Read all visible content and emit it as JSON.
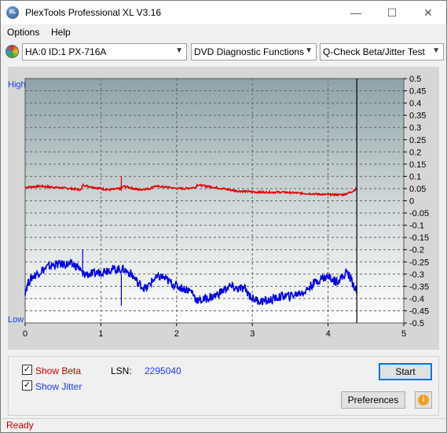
{
  "window": {
    "title": "PlexTools Professional XL V3.16",
    "icon_label": "XL",
    "minimize": "—",
    "maximize": "☐",
    "close": "✕"
  },
  "menu": {
    "options": "Options",
    "help": "Help"
  },
  "toolbar": {
    "drive": "HA:0 ID:1  PX-716A",
    "function": "DVD Diagnostic Functions",
    "test": "Q-Check Beta/Jitter Test"
  },
  "chart_data": {
    "type": "line",
    "left_axis": {
      "high_label": "High",
      "low_label": "Low"
    },
    "right_axis": {
      "ticks": [
        "0.5",
        "0.45",
        "0.4",
        "0.35",
        "0.3",
        "0.25",
        "0.2",
        "0.15",
        "0.1",
        "0.05",
        "0",
        "-0.05",
        "-0.1",
        "-0.15",
        "-0.2",
        "-0.25",
        "-0.3",
        "-0.35",
        "-0.4",
        "-0.45",
        "-0.5"
      ],
      "ylim": [
        -0.5,
        0.5
      ]
    },
    "x_axis": {
      "ticks": [
        "0",
        "1",
        "2",
        "3",
        "4",
        "5"
      ],
      "xlim": [
        0,
        5
      ]
    },
    "grid": true,
    "cursor_x": 4.38,
    "series": [
      {
        "color": "#e00000",
        "x": [
          0,
          0.2,
          0.4,
          0.6,
          0.74,
          0.76,
          0.9,
          1.1,
          1.27,
          1.3,
          1.5,
          1.65,
          1.7,
          1.9,
          2.0,
          2.1,
          2.25,
          2.27,
          2.5,
          2.8,
          3.1,
          3.4,
          3.7,
          4.0,
          4.2,
          4.3,
          4.38
        ],
        "y": [
          0.055,
          0.06,
          0.055,
          0.05,
          0.045,
          0.065,
          0.055,
          0.045,
          0.05,
          0.06,
          0.045,
          0.05,
          0.06,
          0.055,
          0.05,
          0.05,
          0.055,
          0.065,
          0.055,
          0.04,
          0.035,
          0.035,
          0.03,
          0.025,
          0.025,
          0.035,
          0.05
        ]
      },
      {
        "color": "#0000e0",
        "x": [
          0,
          0.05,
          0.1,
          0.2,
          0.3,
          0.4,
          0.5,
          0.6,
          0.7,
          0.74,
          0.76,
          0.9,
          1.0,
          1.1,
          1.2,
          1.3,
          1.4,
          1.5,
          1.6,
          1.7,
          1.8,
          1.9,
          2.0,
          2.1,
          2.2,
          2.25,
          2.3,
          2.4,
          2.5,
          2.6,
          2.7,
          2.8,
          2.9,
          3.0,
          3.1,
          3.2,
          3.3,
          3.4,
          3.5,
          3.6,
          3.7,
          3.8,
          3.9,
          4.0,
          4.1,
          4.2,
          4.25,
          4.3,
          4.35,
          4.38
        ],
        "y": [
          -0.37,
          -0.33,
          -0.31,
          -0.29,
          -0.27,
          -0.26,
          -0.26,
          -0.26,
          -0.27,
          -0.29,
          -0.3,
          -0.3,
          -0.29,
          -0.28,
          -0.28,
          -0.28,
          -0.3,
          -0.34,
          -0.36,
          -0.32,
          -0.31,
          -0.33,
          -0.35,
          -0.36,
          -0.37,
          -0.4,
          -0.41,
          -0.4,
          -0.39,
          -0.37,
          -0.35,
          -0.36,
          -0.36,
          -0.4,
          -0.41,
          -0.41,
          -0.4,
          -0.39,
          -0.39,
          -0.38,
          -0.37,
          -0.34,
          -0.32,
          -0.31,
          -0.33,
          -0.31,
          -0.29,
          -0.32,
          -0.35,
          -0.38
        ]
      }
    ]
  },
  "controls": {
    "show_beta_label": "Show Beta",
    "show_jitter_label": "Show Jitter",
    "show_beta_checked": true,
    "show_jitter_checked": true,
    "lsn_label": "LSN:",
    "lsn_value": "2295040",
    "start_button": "Start",
    "preferences_button": "Preferences",
    "info_icon": "i"
  },
  "status": {
    "text": "Ready"
  }
}
